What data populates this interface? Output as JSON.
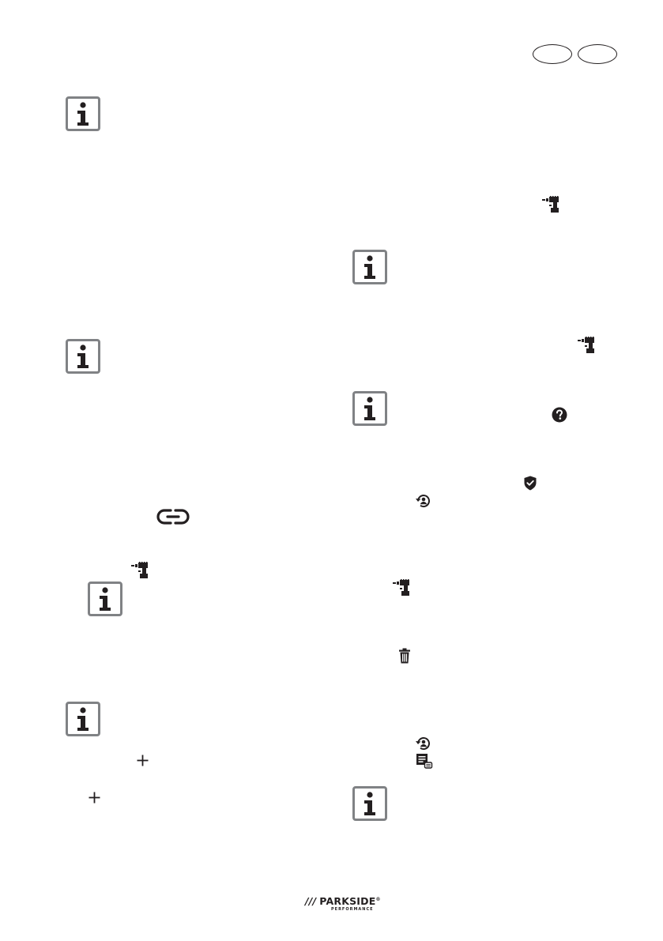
{
  "page": {
    "language_ovals": [
      "",
      ""
    ],
    "brand": {
      "slashes": "///",
      "name": "PARKSIDE",
      "trademark": "®",
      "subline": "PERFORMANCE"
    }
  }
}
